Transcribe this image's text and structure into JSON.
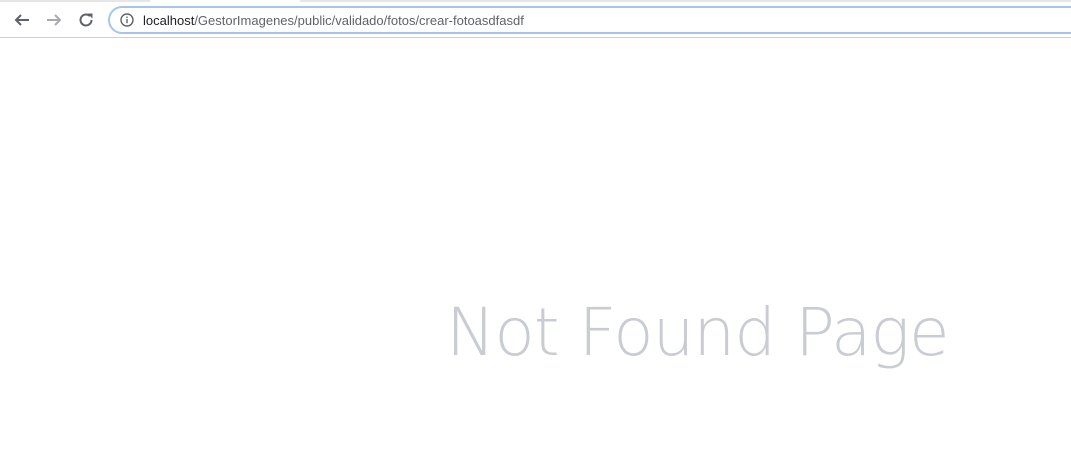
{
  "browser": {
    "url_host": "localhost",
    "url_path": "/GestorImagenes/public/validado/fotos/crear-fotoasdfasdf"
  },
  "icons": {
    "back": "arrow-left-icon",
    "forward": "arrow-right-icon",
    "reload": "reload-icon",
    "site_info": "info-icon"
  },
  "page": {
    "message": "Not Found Page"
  }
}
